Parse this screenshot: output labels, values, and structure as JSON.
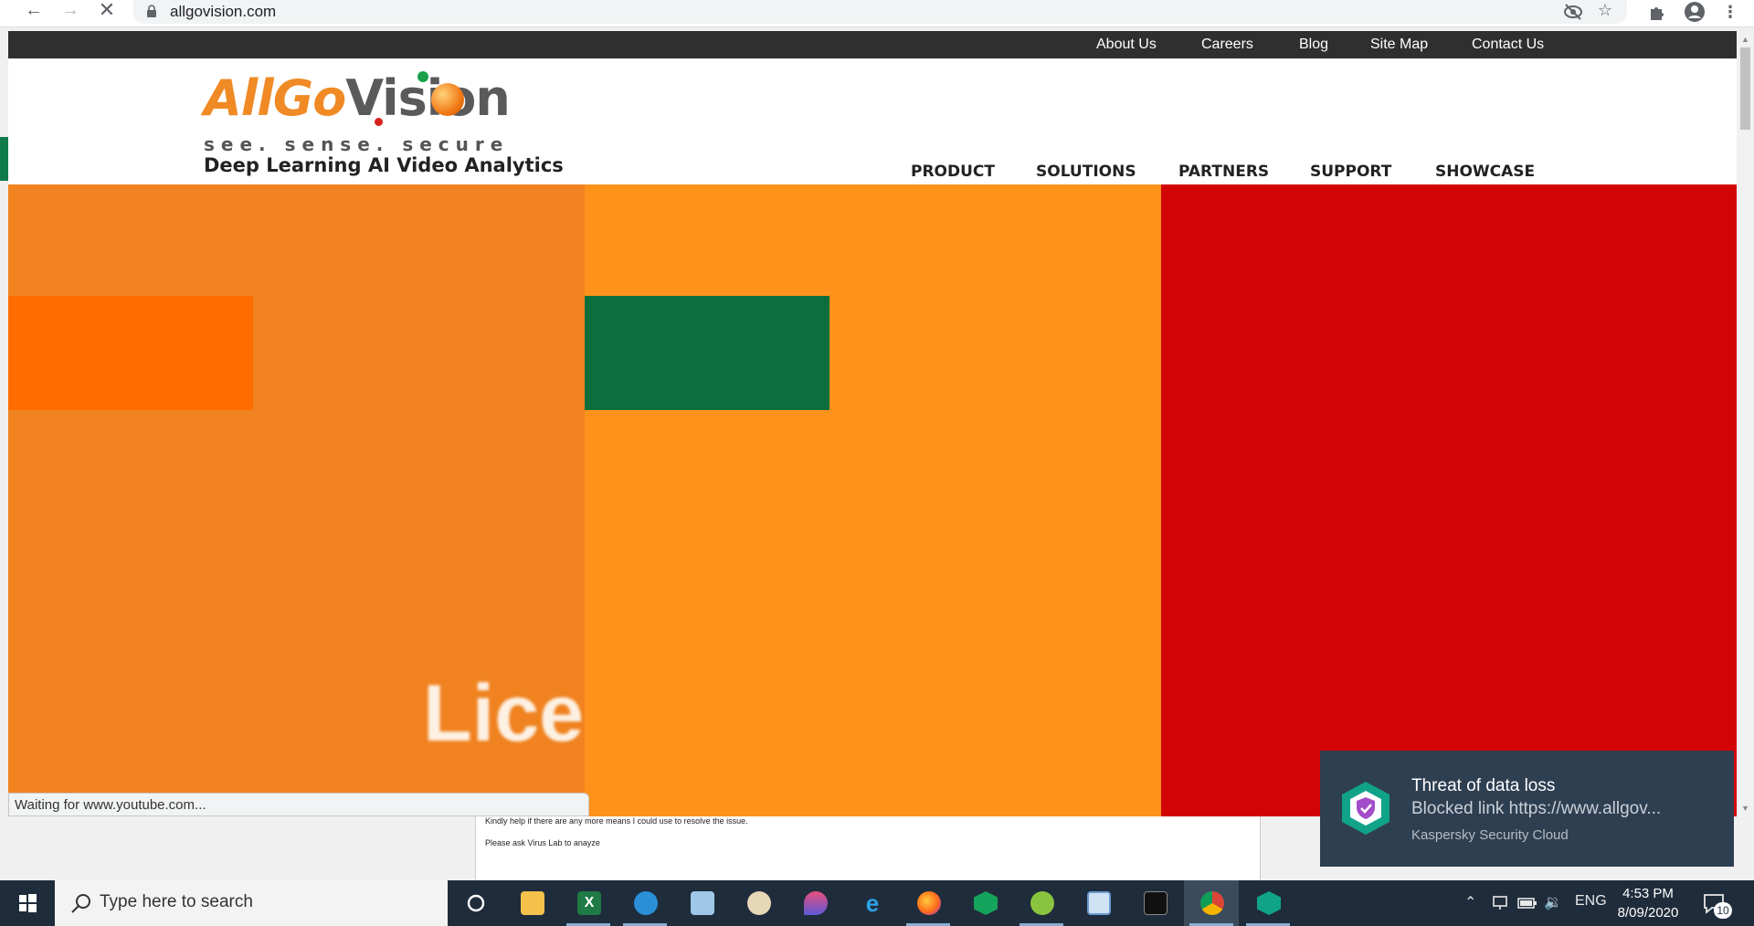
{
  "browser": {
    "url": "allgovision.com",
    "status_text": "Waiting for www.youtube.com..."
  },
  "site": {
    "top_links": [
      "About Us",
      "Careers",
      "Blog",
      "Site Map",
      "Contact Us"
    ],
    "logo": {
      "part1": "AllGo",
      "part2": "Vision"
    },
    "tagline": "see. sense. secure",
    "subtagline": "Deep Learning AI Video Analytics",
    "main_nav": [
      "PRODUCT",
      "SOLUTIONS",
      "PARTNERS",
      "SUPPORT",
      "SHOWCASE"
    ],
    "hero_text": "Licen",
    "colors": {
      "panel1": "#f0821f",
      "panel2": "#fe921a",
      "panel3": "#d30406",
      "block1": "#ff6d00",
      "block2": "#0d6e3d"
    }
  },
  "background_doc": {
    "line1": "Kindly help if there are any more means I could use to resolve the issue.",
    "line2": "Please ask Virus Lab to anayze"
  },
  "toast": {
    "title": "Threat of data loss",
    "message": "Blocked link https://www.allgov...",
    "source": "Kaspersky Security Cloud"
  },
  "taskbar": {
    "search_placeholder": "Type here to search",
    "language": "ENG",
    "time": "4:53 PM",
    "date": "8/09/2020",
    "notification_count": "10"
  }
}
